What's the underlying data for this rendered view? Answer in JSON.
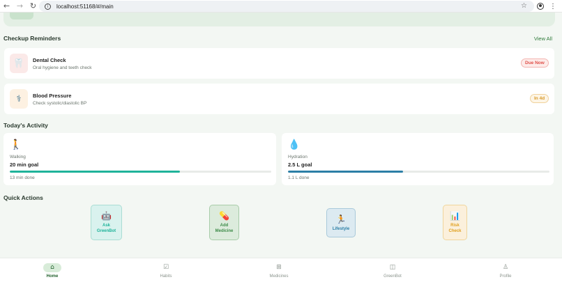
{
  "browser": {
    "url": "localhost:51168/#/main",
    "back_icon": "back-arrow-icon",
    "forward_icon": "forward-arrow-icon",
    "reload_icon": "reload-icon"
  },
  "reminders": {
    "title": "Checkup Reminders",
    "view_all": "View All",
    "items": [
      {
        "title": "Dental Check",
        "subtitle": "Oral hygiene and teeth check",
        "badge": "Due Now",
        "icon": "tooth-icon",
        "badge_color": "#e0504a"
      },
      {
        "title": "Blood Pressure",
        "subtitle": "Check systolic/diastolic BP",
        "badge": "In 4d",
        "icon": "stethoscope-icon",
        "badge_color": "#d99a2b"
      }
    ]
  },
  "activity": {
    "title": "Today's Activity",
    "items": [
      {
        "label": "Walking",
        "goal": "20 min goal",
        "done": "13 min done",
        "progress": 0.65,
        "icon": "walking-person-icon",
        "color": "#1fb39a"
      },
      {
        "label": "Hydration",
        "goal": "2.5 L goal",
        "done": "1.1 L done",
        "progress": 0.44,
        "icon": "water-drop-icon",
        "color": "#2c7fa6"
      }
    ]
  },
  "quick_actions": {
    "title": "Quick Actions",
    "items": [
      {
        "label": "Ask\nGreenBot",
        "icon": "robot-icon",
        "color": "#1fb39a"
      },
      {
        "label": "Add\nMedicine",
        "icon": "pill-icon",
        "color": "#3d8b48"
      },
      {
        "label": "Lifestyle",
        "icon": "running-person-icon",
        "color": "#2c7fa6"
      },
      {
        "label": "Risk\nCheck",
        "icon": "bar-chart-icon",
        "color": "#e0a020"
      }
    ]
  },
  "bottom_nav": {
    "items": [
      {
        "label": "Home",
        "icon": "home-icon",
        "active": true
      },
      {
        "label": "Habits",
        "icon": "checklist-icon",
        "active": false
      },
      {
        "label": "Medicines",
        "icon": "medicine-box-icon",
        "active": false
      },
      {
        "label": "GreenBot",
        "icon": "robot-icon",
        "active": false
      },
      {
        "label": "Profile",
        "icon": "person-icon",
        "active": false
      }
    ]
  }
}
